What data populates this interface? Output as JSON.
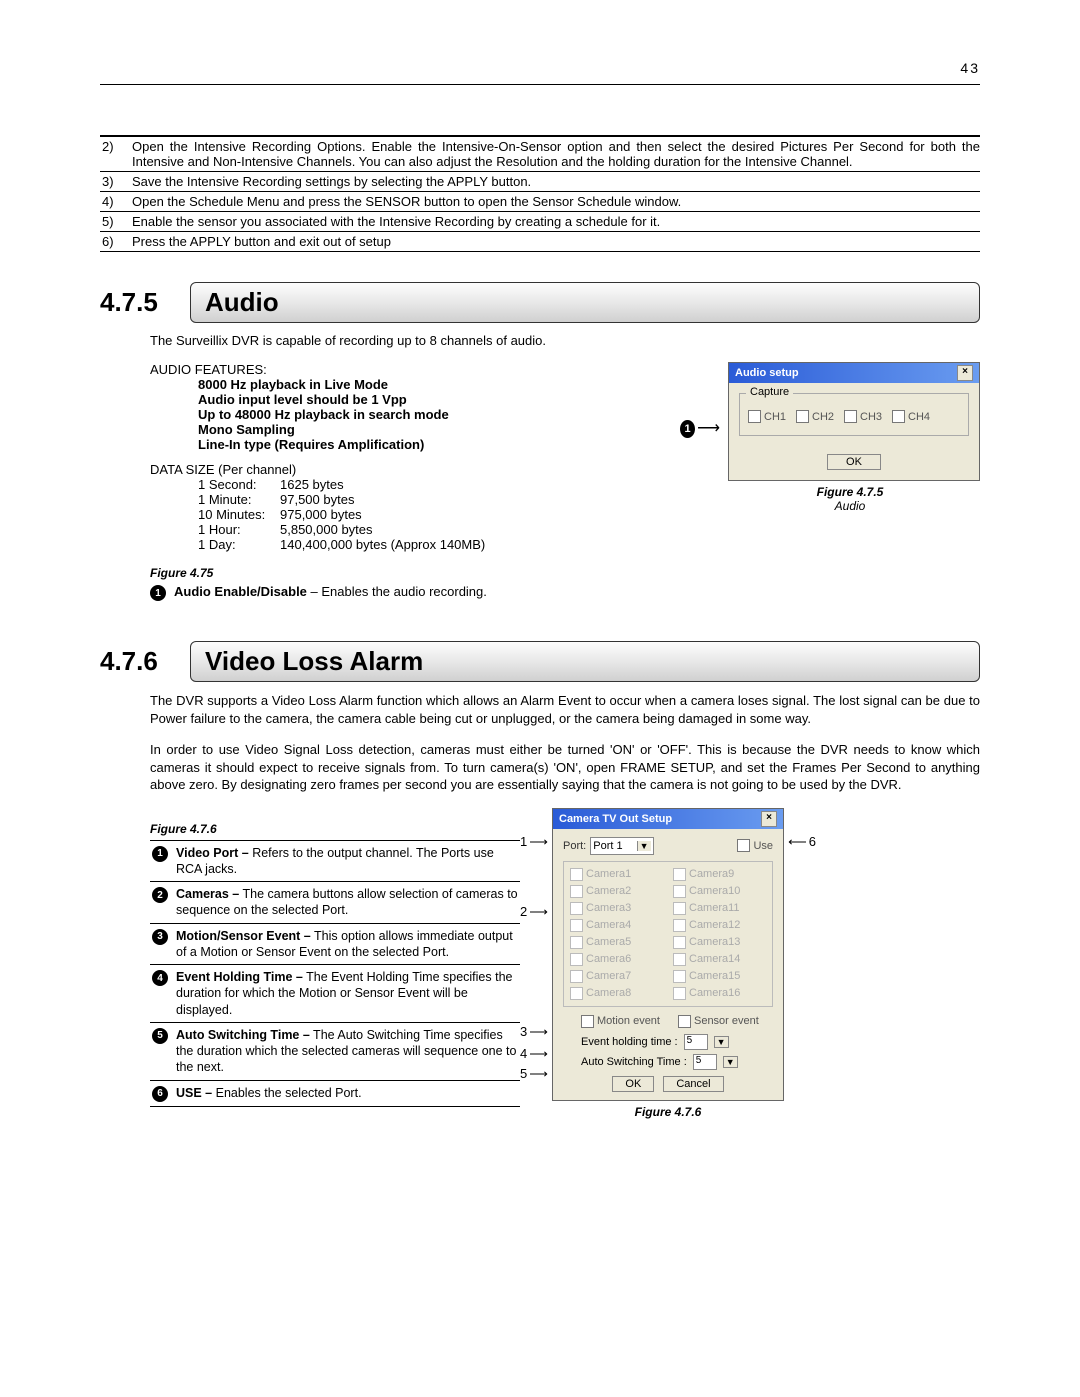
{
  "page_number": "43",
  "steps": [
    {
      "num": "2)",
      "text": "Open the Intensive Recording Options. Enable the Intensive-On-Sensor option and then select the desired Pictures Per Second for both the Intensive and Non-Intensive Channels. You can also adjust the Resolution and the holding duration for the Intensive Channel."
    },
    {
      "num": "3)",
      "text": "Save the Intensive Recording settings by selecting the APPLY button."
    },
    {
      "num": "4)",
      "text": "Open the Schedule Menu and press the SENSOR button to open the Sensor Schedule window."
    },
    {
      "num": "5)",
      "text": "Enable the sensor you associated with the Intensive Recording by creating a schedule for it."
    },
    {
      "num": "6)",
      "text": "Press the APPLY button and exit out of setup"
    }
  ],
  "sec_475": {
    "number": "4.7.5",
    "title": "Audio",
    "intro": "The Surveillix DVR is capable of recording up to 8 channels of audio.",
    "features_heading": "AUDIO FEATURES:",
    "features": [
      "8000 Hz playback in Live Mode",
      "Audio input level should be 1 Vpp",
      "Up to 48000 Hz playback in search mode",
      "Mono Sampling",
      "Line-In type (Requires Amplification)"
    ],
    "data_size_heading": "DATA SIZE (Per channel)",
    "data_size": [
      {
        "label": "1 Second:",
        "value": "1625 bytes"
      },
      {
        "label": "1 Minute:",
        "value": "97,500 bytes"
      },
      {
        "label": "10 Minutes:",
        "value": "975,000 bytes"
      },
      {
        "label": "1 Hour:",
        "value": "5,850,000 bytes"
      },
      {
        "label": "1 Day:",
        "value": "140,400,000 bytes (Approx 140MB)"
      }
    ],
    "callout_num": "1",
    "dialog": {
      "title": "Audio setup",
      "group": "Capture",
      "channels": [
        "CH1",
        "CH2",
        "CH3",
        "CH4"
      ],
      "ok": "OK"
    },
    "fig_caption": "Figure 4.7.5",
    "fig_sub": "Audio",
    "fig_left": "Figure 4.75",
    "desc_bold": "Audio Enable/Disable",
    "desc_rest": " – Enables the audio recording."
  },
  "sec_476": {
    "number": "4.7.6",
    "title": "Video Loss Alarm",
    "para1": "The DVR supports a Video Loss Alarm function which allows an Alarm Event to occur when a camera loses signal. The lost signal can be due to Power failure to the camera, the camera cable being cut or unplugged, or the camera being damaged in some way.",
    "para2": "In order to use Video Signal Loss detection, cameras must either be turned 'ON' or 'OFF'. This is because the DVR needs to know which cameras it should expect to receive signals from. To turn camera(s) 'ON', open FRAME SETUP, and set the Frames Per Second to anything above zero. By designating zero frames per second you are essentially saying that the camera is not going to be used by the DVR.",
    "fig_left": "Figure 4.7.6",
    "desc": [
      {
        "num": "1",
        "bold": "Video Port –",
        "rest": " Refers to the output channel.  The Ports use RCA jacks."
      },
      {
        "num": "2",
        "bold": "Cameras –",
        "rest": " The camera buttons allow selection of cameras to sequence on the selected Port."
      },
      {
        "num": "3",
        "bold": "Motion/Sensor Event –",
        "rest": " This option allows immediate output of a Motion or Sensor Event on the selected Port."
      },
      {
        "num": "4",
        "bold": "Event Holding Time –",
        "rest": " The Event Holding Time specifies the duration for  which the Motion or Sensor Event will be displayed."
      },
      {
        "num": "5",
        "bold": "Auto Switching Time –",
        "rest": " The Auto Switching Time specifies the duration which the selected cameras will sequence one to the next."
      },
      {
        "num": "6",
        "bold": "USE –",
        "rest": " Enables the selected Port."
      }
    ],
    "dialog": {
      "title": "Camera TV Out Setup",
      "port_label": "Port:",
      "port_value": "Port 1",
      "use_label": "Use",
      "cameras": [
        "Camera1",
        "Camera2",
        "Camera9",
        "Camera10",
        "Camera3",
        "Camera11",
        "Camera4",
        "Camera12",
        "Camera5",
        "Camera13",
        "Camera6",
        "Camera14",
        "Camera7",
        "Camera15",
        "Camera8",
        "Camera16"
      ],
      "motion_label": "Motion event",
      "sensor_label": "Sensor event",
      "eht_label": "Event holding time :",
      "eht_value": "5",
      "ast_label": "Auto Switching Time :",
      "ast_value": "5",
      "ok": "OK",
      "cancel": "Cancel"
    },
    "fig_caption": "Figure 4.7.6"
  }
}
